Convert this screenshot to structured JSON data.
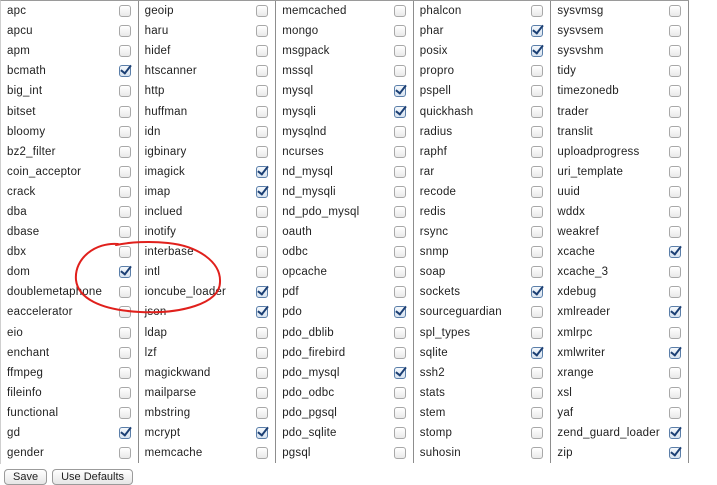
{
  "extensions": [
    [
      {
        "name": "apc",
        "checked": false
      },
      {
        "name": "apcu",
        "checked": false
      },
      {
        "name": "apm",
        "checked": false
      },
      {
        "name": "bcmath",
        "checked": true
      },
      {
        "name": "big_int",
        "checked": false
      },
      {
        "name": "bitset",
        "checked": false
      },
      {
        "name": "bloomy",
        "checked": false
      },
      {
        "name": "bz2_filter",
        "checked": false
      },
      {
        "name": "coin_acceptor",
        "checked": false
      },
      {
        "name": "crack",
        "checked": false
      },
      {
        "name": "dba",
        "checked": false
      },
      {
        "name": "dbase",
        "checked": false
      },
      {
        "name": "dbx",
        "checked": false
      },
      {
        "name": "dom",
        "checked": true
      },
      {
        "name": "doublemetaphone",
        "checked": false
      },
      {
        "name": "eaccelerator",
        "checked": false
      },
      {
        "name": "eio",
        "checked": false
      },
      {
        "name": "enchant",
        "checked": false
      },
      {
        "name": "ffmpeg",
        "checked": false
      },
      {
        "name": "fileinfo",
        "checked": false
      },
      {
        "name": "functional",
        "checked": false
      },
      {
        "name": "gd",
        "checked": true
      },
      {
        "name": "gender",
        "checked": false
      }
    ],
    [
      {
        "name": "geoip",
        "checked": false
      },
      {
        "name": "haru",
        "checked": false
      },
      {
        "name": "hidef",
        "checked": false
      },
      {
        "name": "htscanner",
        "checked": false
      },
      {
        "name": "http",
        "checked": false
      },
      {
        "name": "huffman",
        "checked": false
      },
      {
        "name": "idn",
        "checked": false
      },
      {
        "name": "igbinary",
        "checked": false
      },
      {
        "name": "imagick",
        "checked": true
      },
      {
        "name": "imap",
        "checked": true
      },
      {
        "name": "inclued",
        "checked": false
      },
      {
        "name": "inotify",
        "checked": false
      },
      {
        "name": "interbase",
        "checked": false
      },
      {
        "name": "intl",
        "checked": false
      },
      {
        "name": "ioncube_loader",
        "checked": true
      },
      {
        "name": "json",
        "checked": true
      },
      {
        "name": "ldap",
        "checked": false
      },
      {
        "name": "lzf",
        "checked": false
      },
      {
        "name": "magickwand",
        "checked": false
      },
      {
        "name": "mailparse",
        "checked": false
      },
      {
        "name": "mbstring",
        "checked": false
      },
      {
        "name": "mcrypt",
        "checked": true
      },
      {
        "name": "memcache",
        "checked": false
      }
    ],
    [
      {
        "name": "memcached",
        "checked": false
      },
      {
        "name": "mongo",
        "checked": false
      },
      {
        "name": "msgpack",
        "checked": false
      },
      {
        "name": "mssql",
        "checked": false
      },
      {
        "name": "mysql",
        "checked": true
      },
      {
        "name": "mysqli",
        "checked": true
      },
      {
        "name": "mysqlnd",
        "checked": false
      },
      {
        "name": "ncurses",
        "checked": false
      },
      {
        "name": "nd_mysql",
        "checked": false
      },
      {
        "name": "nd_mysqli",
        "checked": false
      },
      {
        "name": "nd_pdo_mysql",
        "checked": false
      },
      {
        "name": "oauth",
        "checked": false
      },
      {
        "name": "odbc",
        "checked": false
      },
      {
        "name": "opcache",
        "checked": false
      },
      {
        "name": "pdf",
        "checked": false
      },
      {
        "name": "pdo",
        "checked": true
      },
      {
        "name": "pdo_dblib",
        "checked": false
      },
      {
        "name": "pdo_firebird",
        "checked": false
      },
      {
        "name": "pdo_mysql",
        "checked": true
      },
      {
        "name": "pdo_odbc",
        "checked": false
      },
      {
        "name": "pdo_pgsql",
        "checked": false
      },
      {
        "name": "pdo_sqlite",
        "checked": false
      },
      {
        "name": "pgsql",
        "checked": false
      }
    ],
    [
      {
        "name": "phalcon",
        "checked": false
      },
      {
        "name": "phar",
        "checked": true
      },
      {
        "name": "posix",
        "checked": true
      },
      {
        "name": "propro",
        "checked": false
      },
      {
        "name": "pspell",
        "checked": false
      },
      {
        "name": "quickhash",
        "checked": false
      },
      {
        "name": "radius",
        "checked": false
      },
      {
        "name": "raphf",
        "checked": false
      },
      {
        "name": "rar",
        "checked": false
      },
      {
        "name": "recode",
        "checked": false
      },
      {
        "name": "redis",
        "checked": false
      },
      {
        "name": "rsync",
        "checked": false
      },
      {
        "name": "snmp",
        "checked": false
      },
      {
        "name": "soap",
        "checked": false
      },
      {
        "name": "sockets",
        "checked": true
      },
      {
        "name": "sourceguardian",
        "checked": false
      },
      {
        "name": "spl_types",
        "checked": false
      },
      {
        "name": "sqlite",
        "checked": true
      },
      {
        "name": "ssh2",
        "checked": false
      },
      {
        "name": "stats",
        "checked": false
      },
      {
        "name": "stem",
        "checked": false
      },
      {
        "name": "stomp",
        "checked": false
      },
      {
        "name": "suhosin",
        "checked": false
      }
    ],
    [
      {
        "name": "sysvmsg",
        "checked": false
      },
      {
        "name": "sysvsem",
        "checked": false
      },
      {
        "name": "sysvshm",
        "checked": false
      },
      {
        "name": "tidy",
        "checked": false
      },
      {
        "name": "timezonedb",
        "checked": false
      },
      {
        "name": "trader",
        "checked": false
      },
      {
        "name": "translit",
        "checked": false
      },
      {
        "name": "uploadprogress",
        "checked": false
      },
      {
        "name": "uri_template",
        "checked": false
      },
      {
        "name": "uuid",
        "checked": false
      },
      {
        "name": "wddx",
        "checked": false
      },
      {
        "name": "weakref",
        "checked": false
      },
      {
        "name": "xcache",
        "checked": true
      },
      {
        "name": "xcache_3",
        "checked": false
      },
      {
        "name": "xdebug",
        "checked": false
      },
      {
        "name": "xmlreader",
        "checked": true
      },
      {
        "name": "xmlrpc",
        "checked": false
      },
      {
        "name": "xmlwriter",
        "checked": true
      },
      {
        "name": "xrange",
        "checked": false
      },
      {
        "name": "xsl",
        "checked": false
      },
      {
        "name": "yaf",
        "checked": false
      },
      {
        "name": "zend_guard_loader",
        "checked": true
      },
      {
        "name": "zip",
        "checked": true
      }
    ]
  ],
  "actions": {
    "save_label": "Save",
    "defaults_label": "Use Defaults"
  },
  "colors": {
    "annotation": "#e0201c",
    "check": "#1b3f74"
  }
}
